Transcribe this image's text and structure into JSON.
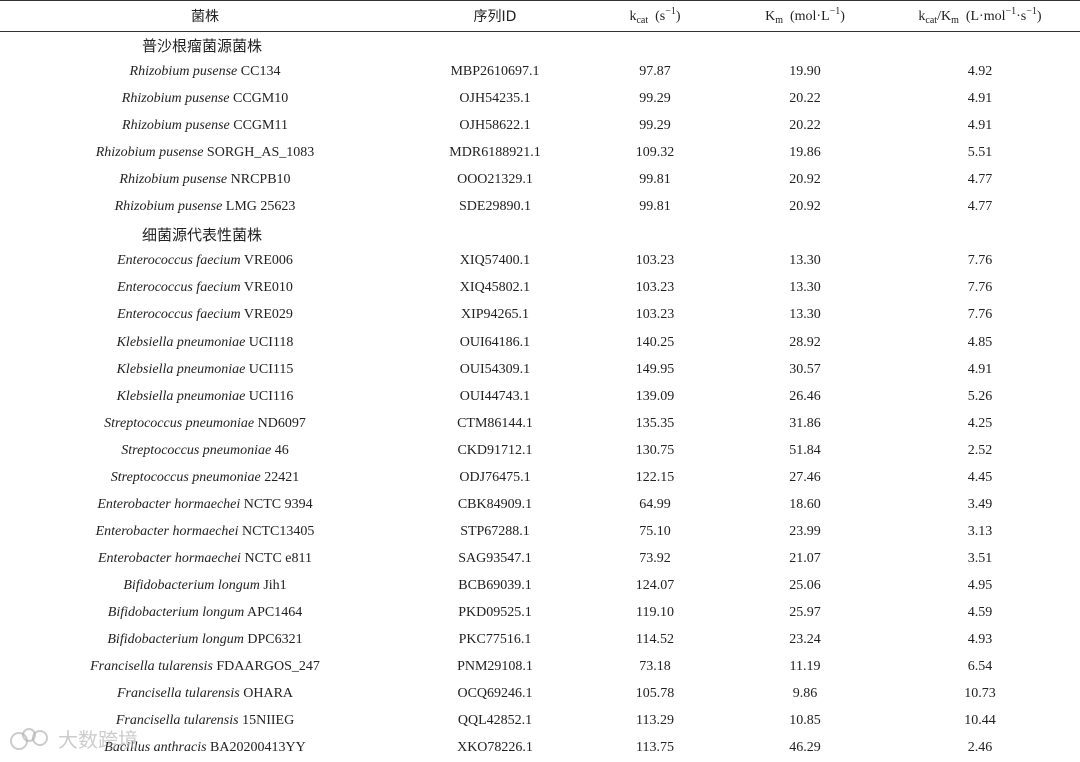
{
  "header": {
    "strain": "菌株",
    "seq_id": "序列ID",
    "kcat_main": "k",
    "kcat_sub": "cat",
    "kcat_unit": "(s",
    "kcat_unit_sup": "−1",
    "kcat_unit_close": ")",
    "km_main": "K",
    "km_sub": "m",
    "km_unit": "(mol·L",
    "km_unit_sup": "−1",
    "km_unit_close": ")",
    "ratio_k": "k",
    "ratio_k_sub": "cat",
    "ratio_slash": "/K",
    "ratio_m_sub": "m",
    "ratio_unit": "(L·mol",
    "ratio_unit_sup1": "−1",
    "ratio_unit_mid": "·s",
    "ratio_unit_sup2": "−1",
    "ratio_unit_close": ")"
  },
  "groups": [
    {
      "title": "普沙根瘤菌源菌株",
      "rows": [
        {
          "species": "Rhizobium pusense",
          "strain": "CC134",
          "id": "MBP2610697.1",
          "kcat": "97.87",
          "km": "19.90",
          "ratio": "4.92"
        },
        {
          "species": "Rhizobium pusense",
          "strain": "CCGM10",
          "id": "OJH54235.1",
          "kcat": "99.29",
          "km": "20.22",
          "ratio": "4.91"
        },
        {
          "species": "Rhizobium pusense",
          "strain": "CCGM11",
          "id": "OJH58622.1",
          "kcat": "99.29",
          "km": "20.22",
          "ratio": "4.91"
        },
        {
          "species": "Rhizobium pusense",
          "strain": "SORGH_AS_1083",
          "id": "MDR6188921.1",
          "kcat": "109.32",
          "km": "19.86",
          "ratio": "5.51"
        },
        {
          "species": "Rhizobium pusense",
          "strain": "NRCPB10",
          "id": "OOO21329.1",
          "kcat": "99.81",
          "km": "20.92",
          "ratio": "4.77"
        },
        {
          "species": "Rhizobium pusense",
          "strain": "LMG 25623",
          "id": "SDE29890.1",
          "kcat": "99.81",
          "km": "20.92",
          "ratio": "4.77"
        }
      ]
    },
    {
      "title": "细菌源代表性菌株",
      "rows": [
        {
          "species": "Enterococcus faecium",
          "strain": "VRE006",
          "id": "XIQ57400.1",
          "kcat": "103.23",
          "km": "13.30",
          "ratio": "7.76"
        },
        {
          "species": "Enterococcus faecium",
          "strain": "VRE010",
          "id": "XIQ45802.1",
          "kcat": "103.23",
          "km": "13.30",
          "ratio": "7.76"
        },
        {
          "species": "Enterococcus faecium",
          "strain": "VRE029",
          "id": "XIP94265.1",
          "kcat": "103.23",
          "km": "13.30",
          "ratio": "7.76"
        },
        {
          "species": "Klebsiella pneumoniae",
          "strain": "UCI118",
          "id": "OUI64186.1",
          "kcat": "140.25",
          "km": "28.92",
          "ratio": "4.85"
        },
        {
          "species": "Klebsiella pneumoniae",
          "strain": "UCI115",
          "id": "OUI54309.1",
          "kcat": "149.95",
          "km": "30.57",
          "ratio": "4.91"
        },
        {
          "species": "Klebsiella pneumoniae",
          "strain": "UCI116",
          "id": "OUI44743.1",
          "kcat": "139.09",
          "km": "26.46",
          "ratio": "5.26"
        },
        {
          "species": "Streptococcus pneumoniae",
          "strain": "ND6097",
          "id": "CTM86144.1",
          "kcat": "135.35",
          "km": "31.86",
          "ratio": "4.25"
        },
        {
          "species": "Streptococcus pneumoniae",
          "strain": "46",
          "id": "CKD91712.1",
          "kcat": "130.75",
          "km": "51.84",
          "ratio": "2.52"
        },
        {
          "species": "Streptococcus pneumoniae",
          "strain": "22421",
          "id": "ODJ76475.1",
          "kcat": "122.15",
          "km": "27.46",
          "ratio": "4.45"
        },
        {
          "species": "Enterobacter hormaechei",
          "strain": "NCTC 9394",
          "id": "CBK84909.1",
          "kcat": "64.99",
          "km": "18.60",
          "ratio": "3.49"
        },
        {
          "species": "Enterobacter hormaechei",
          "strain": "NCTC13405",
          "id": "STP67288.1",
          "kcat": "75.10",
          "km": "23.99",
          "ratio": "3.13"
        },
        {
          "species": "Enterobacter hormaechei",
          "strain": "NCTC e811",
          "id": "SAG93547.1",
          "kcat": "73.92",
          "km": "21.07",
          "ratio": "3.51"
        },
        {
          "species": "Bifidobacterium longum",
          "strain": "Jih1",
          "id": "BCB69039.1",
          "kcat": "124.07",
          "km": "25.06",
          "ratio": "4.95"
        },
        {
          "species": "Bifidobacterium longum",
          "strain": "APC1464",
          "id": "PKD09525.1",
          "kcat": "119.10",
          "km": "25.97",
          "ratio": "4.59"
        },
        {
          "species": "Bifidobacterium longum",
          "strain": "DPC6321",
          "id": "PKC77516.1",
          "kcat": "114.52",
          "km": "23.24",
          "ratio": "4.93"
        },
        {
          "species": "Francisella tularensis",
          "strain": "FDAARGOS_247",
          "id": "PNM29108.1",
          "kcat": "73.18",
          "km": "11.19",
          "ratio": "6.54"
        },
        {
          "species": "Francisella tularensis",
          "strain": "OHARA",
          "id": "OCQ69246.1",
          "kcat": "105.78",
          "km": "9.86",
          "ratio": "10.73"
        },
        {
          "species": "Francisella tularensis",
          "strain": "15NIIEG",
          "id": "QQL42852.1",
          "kcat": "113.29",
          "km": "10.85",
          "ratio": "10.44"
        },
        {
          "species": "Bacillus anthracis",
          "strain": "BA20200413YY",
          "id": "XKO78226.1",
          "kcat": "113.75",
          "km": "46.29",
          "ratio": "2.46"
        }
      ]
    }
  ],
  "watermark": {
    "text": "大数跨境"
  }
}
